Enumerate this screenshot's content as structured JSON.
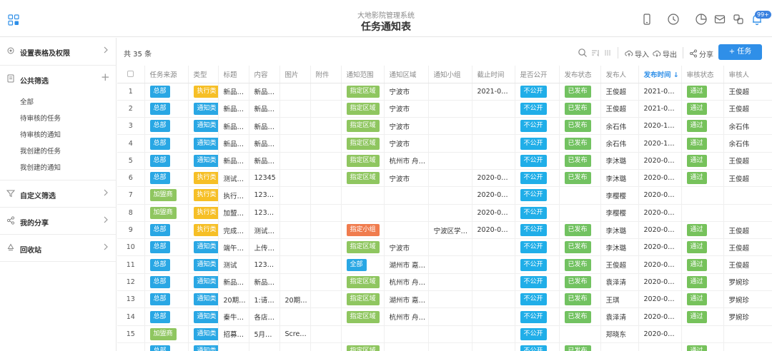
{
  "header": {
    "app_subtitle": "大地影院管理系统",
    "title": "任务通知表",
    "notification_badge": "99+",
    "icons": [
      "grid-icon",
      "phone-icon",
      "clock-icon",
      "pie-chart-icon",
      "inbox-icon",
      "share-alt-icon",
      "bell-icon"
    ]
  },
  "sidebar": {
    "sections": [
      {
        "label": "设置表格及权限",
        "icon": "settings-icon"
      },
      {
        "label": "公共筛选",
        "icon": "document-icon"
      },
      {
        "label": "自定义筛选",
        "icon": "filter-icon"
      },
      {
        "label": "我的分享",
        "icon": "share-icon"
      },
      {
        "label": "回收站",
        "icon": "recycle-icon"
      }
    ],
    "public_filters": [
      "全部",
      "待审核的任务",
      "待审核的通知",
      "我创建的任务",
      "我创建的通知"
    ]
  },
  "toolbar": {
    "total": "共 35 条",
    "import_label": "导入",
    "export_label": "导出",
    "share_label": "分享",
    "add_label": "+ 任务"
  },
  "colors": {
    "accent": "#2f8fe8",
    "tag_blue": "#29a7e4",
    "tag_yellow": "#f6bf26",
    "tag_green": "#8fc660",
    "tag_orange": "#f07c4e",
    "tag_public": "#20aee8",
    "tag_pass": "#76c25b",
    "tag_published": "#72c261"
  },
  "table": {
    "columns": [
      "任务来源",
      "类型",
      "标题",
      "内容",
      "图片",
      "附件",
      "通知范围",
      "通知区域",
      "通知小组",
      "截止时间",
      "是否公开",
      "发布状态",
      "发布人",
      "发布时间",
      "审核状态",
      "审核人"
    ],
    "sorted_column": "发布时间",
    "rows": [
      {
        "no": "1",
        "src": "总部",
        "type": "执行类",
        "title": "新品…",
        "content": "新品…",
        "img": "",
        "att": "",
        "scope": "指定区域",
        "area": "宁波市",
        "group": "",
        "deadline": "2021-0…",
        "public": "不公开",
        "status": "已发布",
        "publisher": "王俊超",
        "time": "2021-0…",
        "review": "通过",
        "reviewer": "王俊超"
      },
      {
        "no": "2",
        "src": "总部",
        "type": "通知类",
        "title": "新品…",
        "content": "新品…",
        "img": "",
        "att": "",
        "scope": "指定区域",
        "area": "宁波市",
        "group": "",
        "deadline": "",
        "public": "不公开",
        "status": "已发布",
        "publisher": "王俊超",
        "time": "2021-0…",
        "review": "通过",
        "reviewer": "王俊超"
      },
      {
        "no": "3",
        "src": "总部",
        "type": "通知类",
        "title": "新品…",
        "content": "新品…",
        "img": "",
        "att": "",
        "scope": "指定区域",
        "area": "宁波市",
        "group": "",
        "deadline": "",
        "public": "不公开",
        "status": "已发布",
        "publisher": "余石伟",
        "time": "2020-1…",
        "review": "通过",
        "reviewer": "余石伟"
      },
      {
        "no": "4",
        "src": "总部",
        "type": "通知类",
        "title": "新品…",
        "content": "新品…",
        "img": "",
        "att": "",
        "scope": "指定区域",
        "area": "宁波市",
        "group": "",
        "deadline": "",
        "public": "不公开",
        "status": "已发布",
        "publisher": "余石伟",
        "time": "2020-1…",
        "review": "通过",
        "reviewer": "余石伟"
      },
      {
        "no": "5",
        "src": "总部",
        "type": "通知类",
        "title": "新品…",
        "content": "新品…",
        "img": "",
        "att": "",
        "scope": "指定区域",
        "area": "杭州市 舟…",
        "group": "",
        "deadline": "",
        "public": "不公开",
        "status": "已发布",
        "publisher": "李沐璐",
        "time": "2020-0…",
        "review": "通过",
        "reviewer": "王俊超"
      },
      {
        "no": "6",
        "src": "总部",
        "type": "执行类",
        "title": "测试…",
        "content": "12345",
        "img": "",
        "att": "",
        "scope": "指定区域",
        "area": "宁波市",
        "group": "",
        "deadline": "2020-0…",
        "public": "不公开",
        "status": "已发布",
        "publisher": "李沐璐",
        "time": "2020-0…",
        "review": "通过",
        "reviewer": "王俊超"
      },
      {
        "no": "7",
        "src": "加盟商",
        "type": "执行类",
        "title": "执行…",
        "content": "123…",
        "img": "",
        "att": "",
        "scope": "",
        "area": "",
        "group": "",
        "deadline": "2020-0…",
        "public": "不公开",
        "status": "",
        "publisher": "李樱樱",
        "time": "2020-0…",
        "review": "",
        "reviewer": ""
      },
      {
        "no": "8",
        "src": "加盟商",
        "type": "执行类",
        "title": "加盟…",
        "content": "123…",
        "img": "",
        "att": "",
        "scope": "",
        "area": "",
        "group": "",
        "deadline": "2020-0…",
        "public": "不公开",
        "status": "",
        "publisher": "李樱樱",
        "time": "2020-0…",
        "review": "",
        "reviewer": ""
      },
      {
        "no": "9",
        "src": "总部",
        "type": "执行类",
        "title": "完成…",
        "content": "测试…",
        "img": "",
        "att": "",
        "scope": "指定小组",
        "area": "",
        "group": "宁波区学…",
        "deadline": "2020-0…",
        "public": "不公开",
        "status": "已发布",
        "publisher": "李沐璐",
        "time": "2020-0…",
        "review": "通过",
        "reviewer": "王俊超"
      },
      {
        "no": "10",
        "src": "总部",
        "type": "通知类",
        "title": "端午…",
        "content": "上传…",
        "img": "",
        "att": "",
        "scope": "指定区域",
        "area": "宁波市",
        "group": "",
        "deadline": "",
        "public": "不公开",
        "status": "已发布",
        "publisher": "李沐璐",
        "time": "2020-0…",
        "review": "通过",
        "reviewer": "王俊超"
      },
      {
        "no": "11",
        "src": "总部",
        "type": "通知类",
        "title": "测试",
        "content": "123…",
        "img": "",
        "att": "",
        "scope": "全部",
        "area": "湖州市 嘉…",
        "group": "",
        "deadline": "",
        "public": "不公开",
        "status": "已发布",
        "publisher": "王俊超",
        "time": "2020-0…",
        "review": "通过",
        "reviewer": "王俊超"
      },
      {
        "no": "12",
        "src": "总部",
        "type": "通知类",
        "title": "新品…",
        "content": "新品…",
        "img": "",
        "att": "",
        "scope": "指定区域",
        "area": "杭州市 舟…",
        "group": "",
        "deadline": "",
        "public": "不公开",
        "status": "已发布",
        "publisher": "袁泽清",
        "time": "2020-0…",
        "review": "通过",
        "reviewer": "罗婉珍"
      },
      {
        "no": "13",
        "src": "总部",
        "type": "通知类",
        "title": "20期…",
        "content": "1:请…",
        "img": "20期…",
        "att": "",
        "scope": "指定区域",
        "area": "湖州市 嘉…",
        "group": "",
        "deadline": "",
        "public": "不公开",
        "status": "已发布",
        "publisher": "王琪",
        "time": "2020-0…",
        "review": "通过",
        "reviewer": "罗婉珍"
      },
      {
        "no": "14",
        "src": "总部",
        "type": "通知类",
        "title": "秦牛…",
        "content": "各店…",
        "img": "",
        "att": "",
        "scope": "指定区域",
        "area": "杭州市 舟…",
        "group": "",
        "deadline": "",
        "public": "不公开",
        "status": "已发布",
        "publisher": "袁泽清",
        "time": "2020-0…",
        "review": "通过",
        "reviewer": "罗婉珍"
      },
      {
        "no": "15",
        "src": "加盟商",
        "type": "通知类",
        "title": "招募…",
        "content": "5月…",
        "img": "Scre…",
        "att": "",
        "scope": "",
        "area": "",
        "group": "",
        "deadline": "",
        "public": "不公开",
        "status": "",
        "publisher": "郑晓东",
        "time": "2020-0…",
        "review": "",
        "reviewer": ""
      },
      {
        "no": "",
        "src": "总部",
        "type": "通知类",
        "title": "",
        "content": "",
        "img": "",
        "att": "",
        "scope": "指定区域",
        "area": "",
        "group": "",
        "deadline": "",
        "public": "不公开",
        "status": "已发布",
        "publisher": "",
        "time": "",
        "review": "通过",
        "reviewer": ""
      }
    ]
  }
}
